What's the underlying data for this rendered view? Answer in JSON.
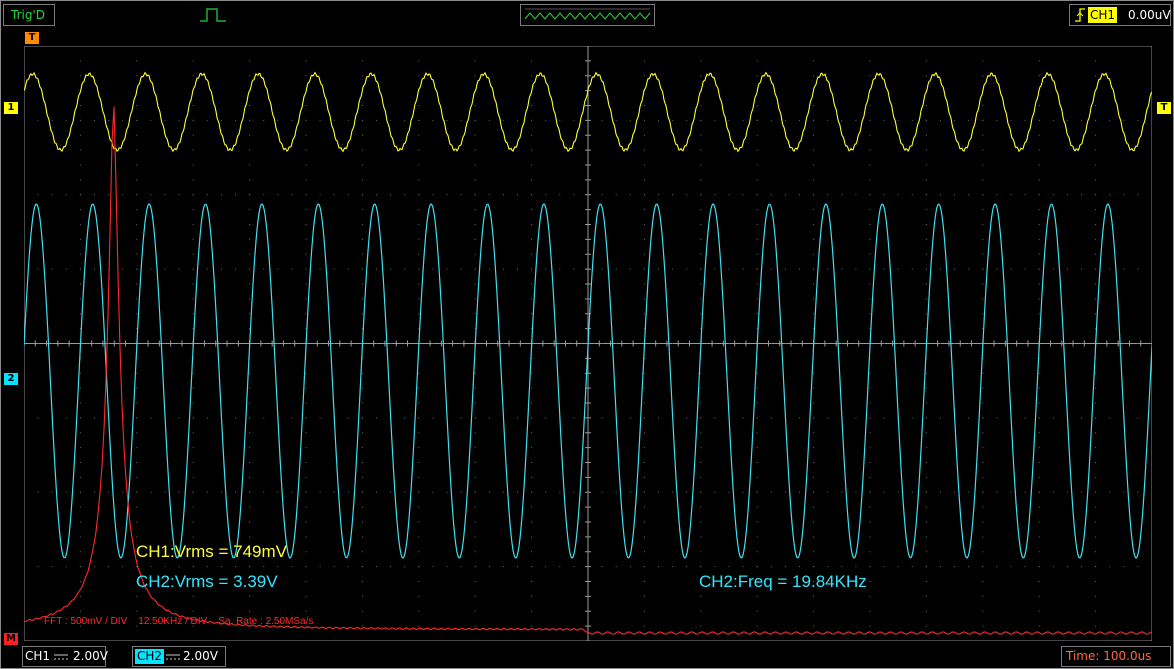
{
  "top_bar": {
    "trigger_status": "Trig'D",
    "trigger_source": "CH1",
    "trigger_level": "0.00uV"
  },
  "markers": {
    "trigger_position": "T",
    "ch1": "1",
    "trigger_level": "T",
    "ch2": "2",
    "math": "M"
  },
  "measurements": {
    "ch1_vrms": "CH1:Vrms = 749mV",
    "ch2_vrms": "CH2:Vrms = 3.39V",
    "ch2_freq": "CH2:Freq = 19.84KHz"
  },
  "fft": {
    "info": "FFT : 500mV / DIV    12.50KHz / DIV    Sa. Rate : 2.50MSa/s"
  },
  "bottom_bar": {
    "ch1": {
      "label": "CH1",
      "scale": "2.00V"
    },
    "ch2": {
      "label": "CH2",
      "scale": "2.00V"
    },
    "timebase": "Time: 100.0us"
  },
  "colors": {
    "ch1": "#ffff33",
    "ch2": "#3fe0f0",
    "math": "#ff2a2a",
    "trigger_status": "#2bd43b",
    "timebase": "#ff6a3d"
  },
  "waveform": {
    "ch1_cycles_per_screen": 20,
    "ch2_cycles_per_screen": 20,
    "fft_peak_frequency_khz": 19.84
  }
}
